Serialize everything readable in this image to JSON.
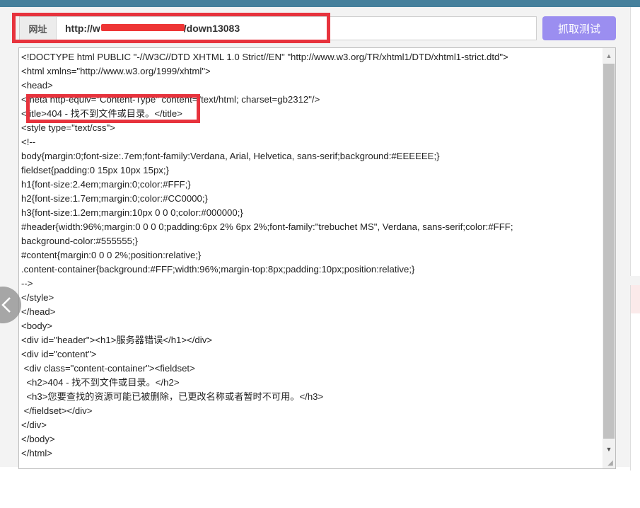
{
  "url_bar": {
    "label": "网址",
    "value_start": "http://w",
    "value_end": "/down13083"
  },
  "fetch_button": {
    "label": "抓取测试"
  },
  "code_lines": [
    "<!DOCTYPE html PUBLIC \"-//W3C//DTD XHTML 1.0 Strict//EN\" \"http://www.w3.org/TR/xhtml1/DTD/xhtml1-strict.dtd\">",
    "<html xmlns=\"http://www.w3.org/1999/xhtml\">",
    "<head>",
    "<meta http-equiv=\"Content-Type\" content=\"text/html; charset=gb2312\"/>",
    "<title>404 - 找不到文件或目录。</title>",
    "<style type=\"text/css\">",
    "<!--",
    "body{margin:0;font-size:.7em;font-family:Verdana, Arial, Helvetica, sans-serif;background:#EEEEEE;}",
    "fieldset{padding:0 15px 10px 15px;}",
    "h1{font-size:2.4em;margin:0;color:#FFF;}",
    "h2{font-size:1.7em;margin:0;color:#CC0000;}",
    "h3{font-size:1.2em;margin:10px 0 0 0;color:#000000;}",
    "#header{width:96%;margin:0 0 0 0;padding:6px 2% 6px 2%;font-family:\"trebuchet MS\", Verdana, sans-serif;color:#FFF;",
    "background-color:#555555;}",
    "#content{margin:0 0 0 2%;position:relative;}",
    ".content-container{background:#FFF;width:96%;margin-top:8px;padding:10px;position:relative;}",
    "-->",
    "</style>",
    "</head>",
    "<body>",
    "<div id=\"header\"><h1>服务器错误</h1></div>",
    "<div id=\"content\">",
    " <div class=\"content-container\"><fieldset>",
    "  <h2>404 - 找不到文件或目录。</h2>",
    "  <h3>您要查找的资源可能已被删除，已更改名称或者暂时不可用。</h3>",
    " </fieldset></div>",
    "</div>",
    "</body>",
    "</html>"
  ],
  "icons": {
    "back": "chevron-left-icon",
    "scroll_up": "scroll-up-arrow",
    "scroll_down": "scroll-down-arrow"
  },
  "colors": {
    "topbar": "#46809c",
    "highlight": "#e7333d",
    "button": "#9b8ef0"
  }
}
